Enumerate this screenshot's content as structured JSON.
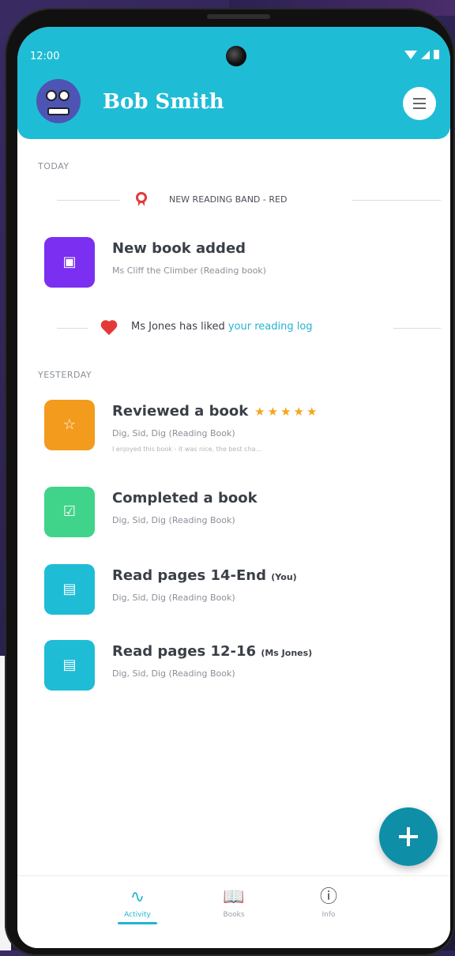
{
  "status_bar": {
    "time": "12:00"
  },
  "header": {
    "user_name": "Bob Smith"
  },
  "feed": {
    "today_label": "TODAY",
    "reading_band_text": "NEW READING BAND - RED",
    "new_book": {
      "title": "New book added",
      "subtitle": "Ms Cliff the Climber (Reading book)"
    },
    "like": {
      "prefix": "Ms Jones has liked ",
      "link": "your reading log"
    },
    "yesterday_label": "YESTERDAY",
    "reviewed": {
      "title": "Reviewed a book",
      "stars": "★★★★★",
      "rating": 5,
      "subtitle": "Dig, Sid, Dig (Reading Book)",
      "note": "I enjoyed this book - it was nice, the best cha..."
    },
    "completed": {
      "title": "Completed a book",
      "subtitle": "Dig, Sid, Dig (Reading Book)"
    },
    "read1": {
      "title": "Read pages 14-End",
      "who": "(You)",
      "subtitle": "Dig, Sid, Dig (Reading Book)"
    },
    "read2": {
      "title": "Read pages 12-16",
      "who": "(Ms Jones)",
      "subtitle": "Dig, Sid, Dig (Reading Book)"
    }
  },
  "nav": {
    "activity": "Activity",
    "books": "Books",
    "info": "Info",
    "active": "activity"
  },
  "colors": {
    "header": "#1fbcd6",
    "purple_tile": "#7b2ff0",
    "orange_tile": "#f29b1d",
    "green_tile": "#3fd489",
    "teal_tile": "#1fbcd6",
    "fab": "#0f8ea8",
    "accent": "#23b5cf"
  },
  "icons": {
    "menu": "menu-icon",
    "fab": "plus-icon",
    "band": "ribbon-icon",
    "like": "heart-icon"
  }
}
